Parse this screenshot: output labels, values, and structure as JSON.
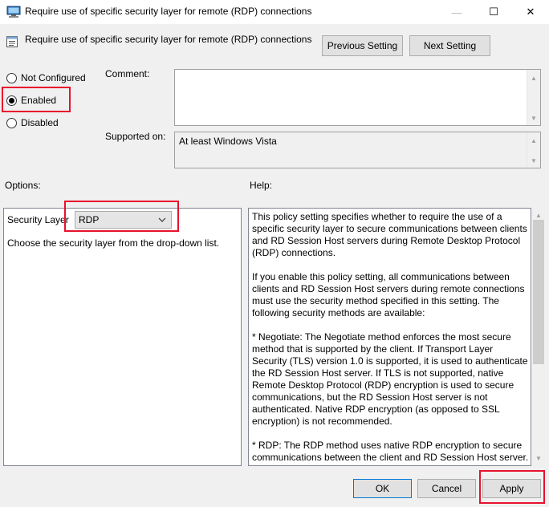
{
  "window": {
    "title": "Require use of specific security layer for remote (RDP) connections",
    "min_glyph": "—",
    "max_glyph": "☐",
    "close_glyph": "✕"
  },
  "header": {
    "policy_title": "Require use of specific security layer for remote (RDP) connections",
    "previous_label": "Previous Setting",
    "next_label": "Next Setting"
  },
  "state": {
    "options": [
      "Not Configured",
      "Enabled",
      "Disabled"
    ],
    "selected": "Enabled"
  },
  "comment": {
    "label": "Comment:",
    "value": ""
  },
  "supported": {
    "label": "Supported on:",
    "value": "At least Windows Vista"
  },
  "options_panel": {
    "label": "Options:",
    "security_label": "Security Layer",
    "security_value": "RDP",
    "description": "Choose the security layer from the drop-down list."
  },
  "help_panel": {
    "label": "Help:",
    "paragraphs": [
      "This policy setting specifies whether to require the use of a specific security layer to secure communications between clients and RD Session Host servers during Remote Desktop Protocol (RDP) connections.",
      "If you enable this policy setting, all communications between clients and RD Session Host servers during remote connections must use the security method specified in this setting. The following security methods are available:",
      "* Negotiate: The Negotiate method enforces the most secure method that is supported by the client. If Transport Layer Security (TLS) version 1.0 is supported, it is used to authenticate the RD Session Host server. If TLS is not supported, native Remote Desktop Protocol (RDP) encryption is used to secure communications, but the RD Session Host server is not authenticated. Native RDP encryption (as opposed to SSL encryption) is not recommended.",
      "* RDP: The RDP method uses native RDP encryption to secure communications between the client and RD Session Host server. If you select this setting, the RD Session Host server is not authenticated."
    ]
  },
  "footer": {
    "ok_label": "OK",
    "cancel_label": "Cancel",
    "apply_label": "Apply"
  },
  "colors": {
    "highlight": "#e8112d",
    "accent": "#0078d7"
  }
}
